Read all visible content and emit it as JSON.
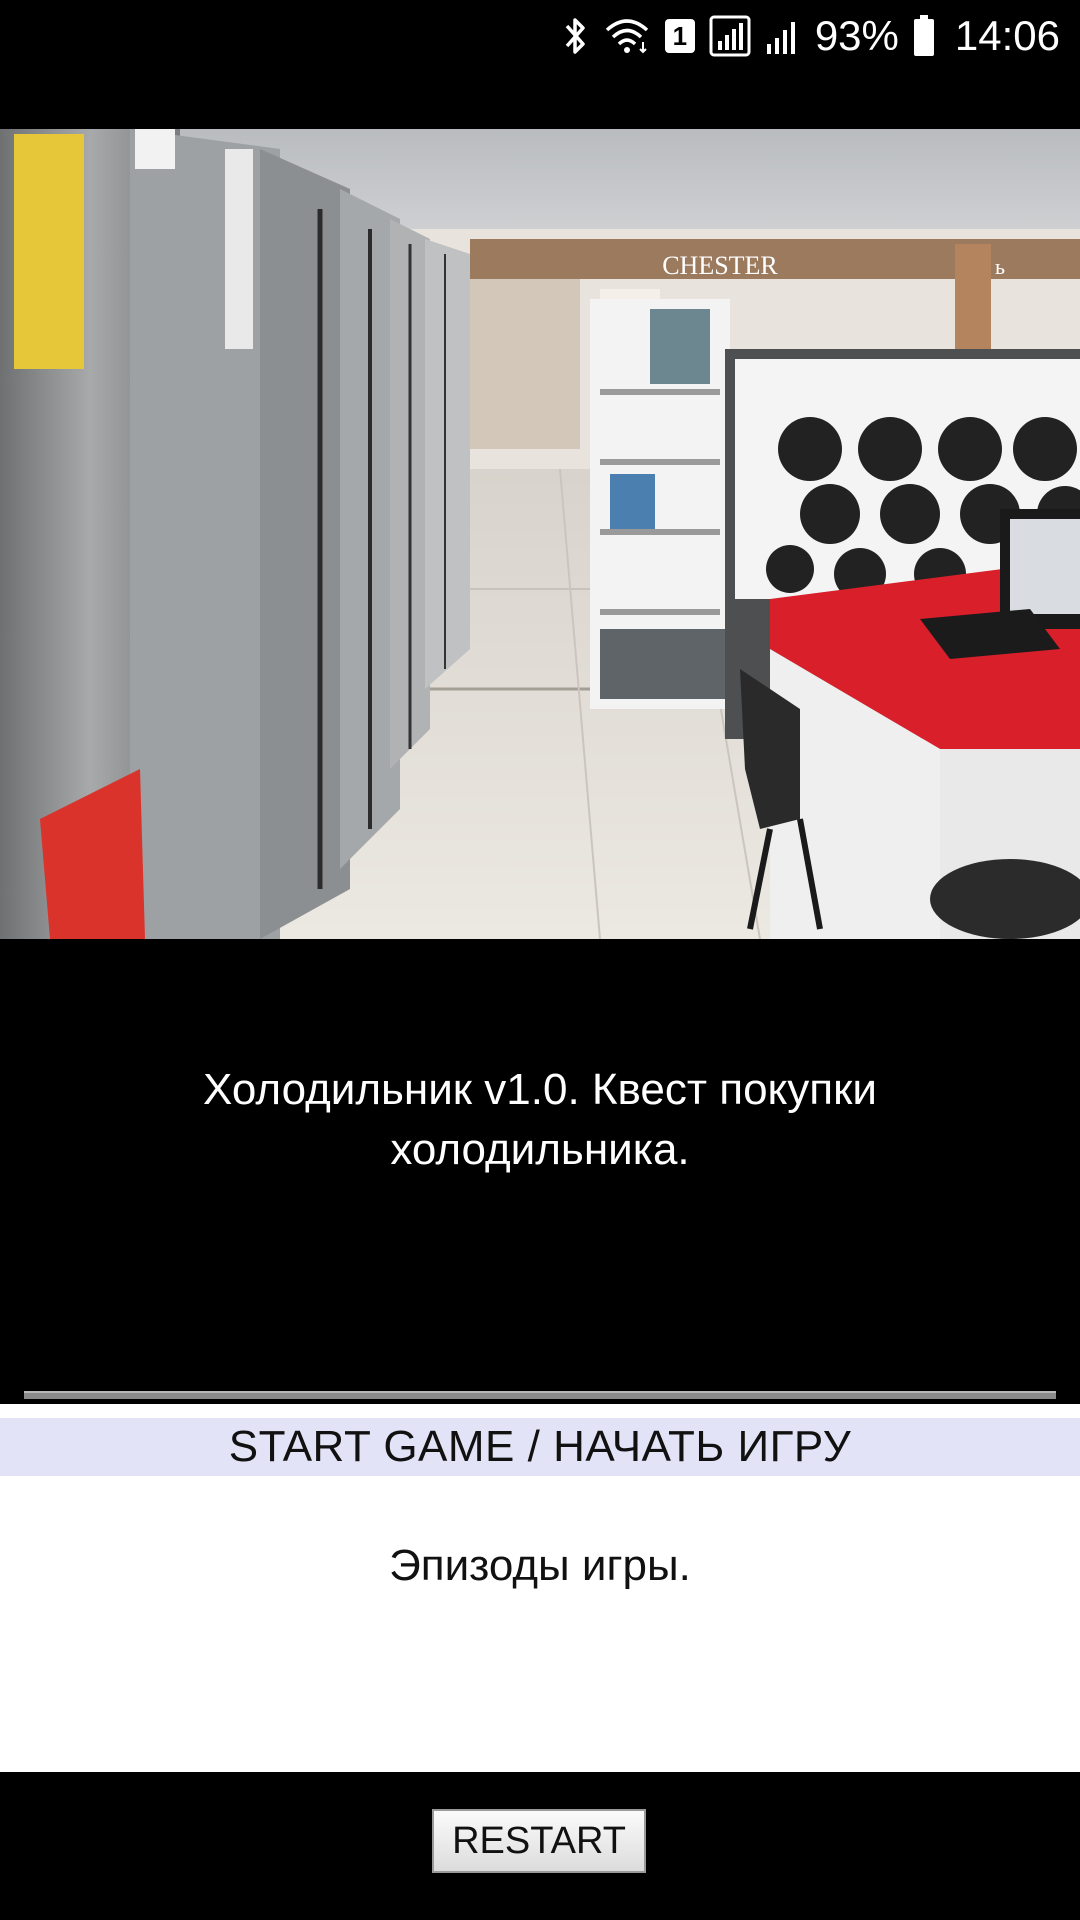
{
  "status_bar": {
    "sim_slot": "1",
    "battery": "93%",
    "time": "14:06",
    "icons": [
      "bluetooth-icon",
      "wifi-icon",
      "sim-icon",
      "signal-icon",
      "signal-icon",
      "battery-icon"
    ]
  },
  "scene": {
    "store_sign": "CHESTER",
    "store_sign_right": "ь"
  },
  "game": {
    "title": "Холодильник v1.0. Квест покупки холодильника.",
    "start_label": "START GAME / НАЧАТЬ ИГРУ",
    "episodes_label": "Эпизоды игры.",
    "restart_label": "RESTART"
  },
  "colors": {
    "start_bg": "#e3e3f7",
    "panel_bg": "#ffffff",
    "page_bg": "#000000"
  }
}
